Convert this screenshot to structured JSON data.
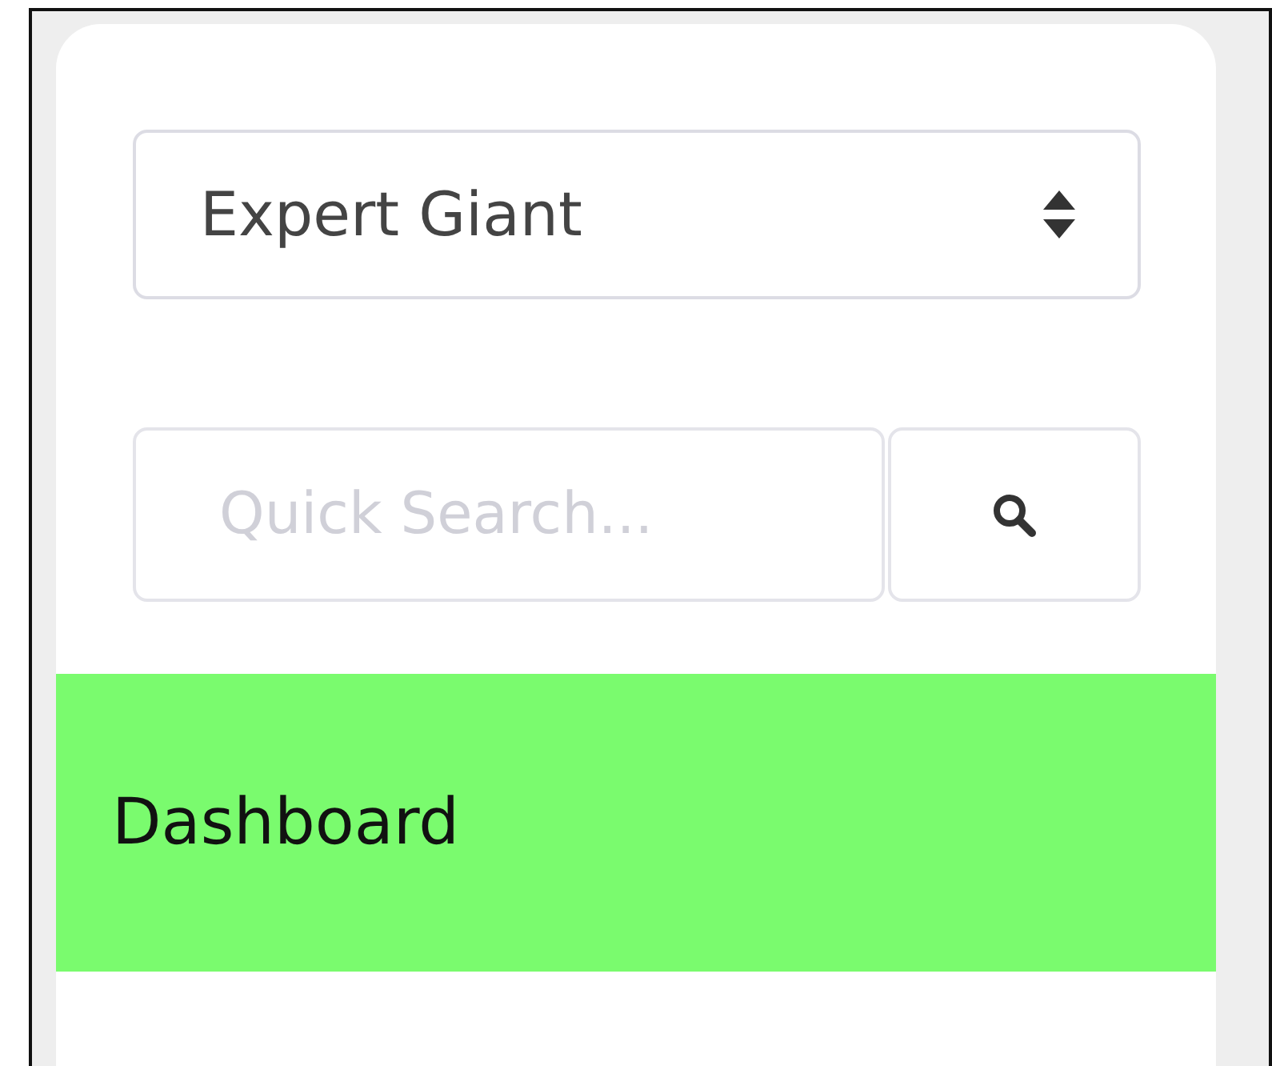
{
  "company_select": {
    "value": "Expert Giant"
  },
  "search": {
    "placeholder": "Quick Search..."
  },
  "nav": [
    {
      "label": "Dashboard",
      "selected": true
    }
  ]
}
